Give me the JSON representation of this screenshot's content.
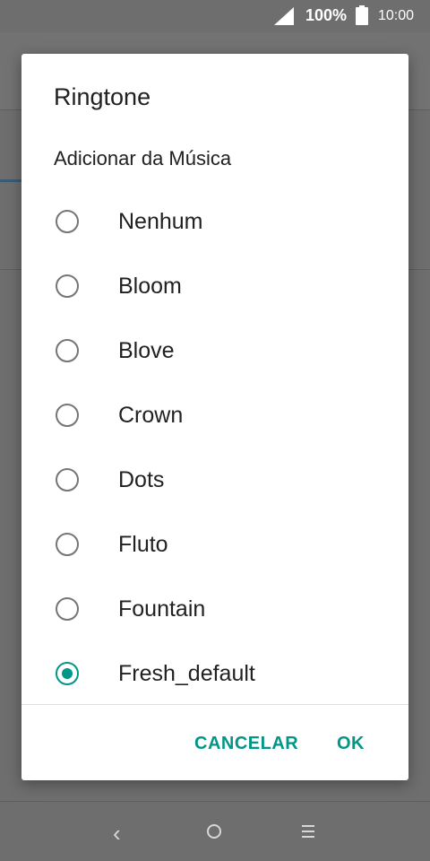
{
  "status_bar": {
    "battery_percent": "100%",
    "time": "10:00",
    "icons": [
      "signal-icon",
      "battery-icon"
    ]
  },
  "dialog": {
    "title": "Ringtone",
    "add_music_label": "Adicionar da Música",
    "options": [
      {
        "label": "Nenhum",
        "selected": false
      },
      {
        "label": "Bloom",
        "selected": false
      },
      {
        "label": "Blove",
        "selected": false
      },
      {
        "label": "Crown",
        "selected": false
      },
      {
        "label": "Dots",
        "selected": false
      },
      {
        "label": "Fluto",
        "selected": false
      },
      {
        "label": "Fountain",
        "selected": false
      },
      {
        "label": "Fresh_default",
        "selected": true
      }
    ],
    "cancel_label": "CANCELAR",
    "ok_label": "OK"
  },
  "nav_bar": {
    "back_glyph": "‹",
    "icons": [
      "back-icon",
      "home-icon",
      "menu-icon"
    ]
  },
  "colors": {
    "accent": "#009688",
    "scrim": "#6e6e6e"
  }
}
